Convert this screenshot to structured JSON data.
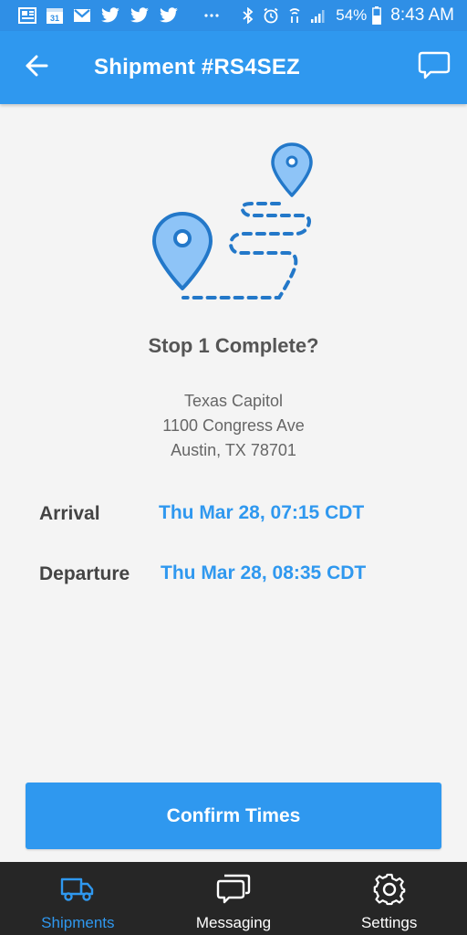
{
  "status_bar": {
    "battery_percent": "54%",
    "time": "8:43 AM",
    "calendar_day": "31",
    "left_icons": [
      "news-icon",
      "calendar-icon",
      "gmail-icon",
      "twitter-icon",
      "twitter-icon",
      "twitter-icon",
      "more-icon"
    ],
    "right_icons": [
      "bluetooth-icon",
      "alarm-icon",
      "wifi-icon",
      "signal-icon",
      "battery-icon"
    ]
  },
  "header": {
    "title": "Shipment #RS4SEZ",
    "back_icon": "arrow-left-icon",
    "chat_icon": "chat-bubble-icon"
  },
  "stop": {
    "title": "Stop 1 Complete?",
    "illustration_icon": "route-map-pins-icon",
    "address": {
      "line1": "Texas Capitol",
      "line2": "1100 Congress Ave",
      "line3": "Austin, TX 78701"
    }
  },
  "times": {
    "arrival_label": "Arrival",
    "arrival_value": "Thu Mar 28, 07:15 CDT",
    "departure_label": "Departure",
    "departure_value": "Thu Mar 28, 08:35 CDT"
  },
  "actions": {
    "confirm_label": "Confirm Times"
  },
  "bottom_nav": {
    "items": [
      {
        "label": "Shipments",
        "icon": "truck-icon",
        "active": true
      },
      {
        "label": "Messaging",
        "icon": "messages-icon",
        "active": false
      },
      {
        "label": "Settings",
        "icon": "gear-icon",
        "active": false
      }
    ]
  },
  "colors": {
    "primary": "#2f98ef",
    "status_bar": "#2f8fe6",
    "nav_background": "#262626",
    "background": "#f4f4f4",
    "pin_fill": "#8ec4f7"
  }
}
